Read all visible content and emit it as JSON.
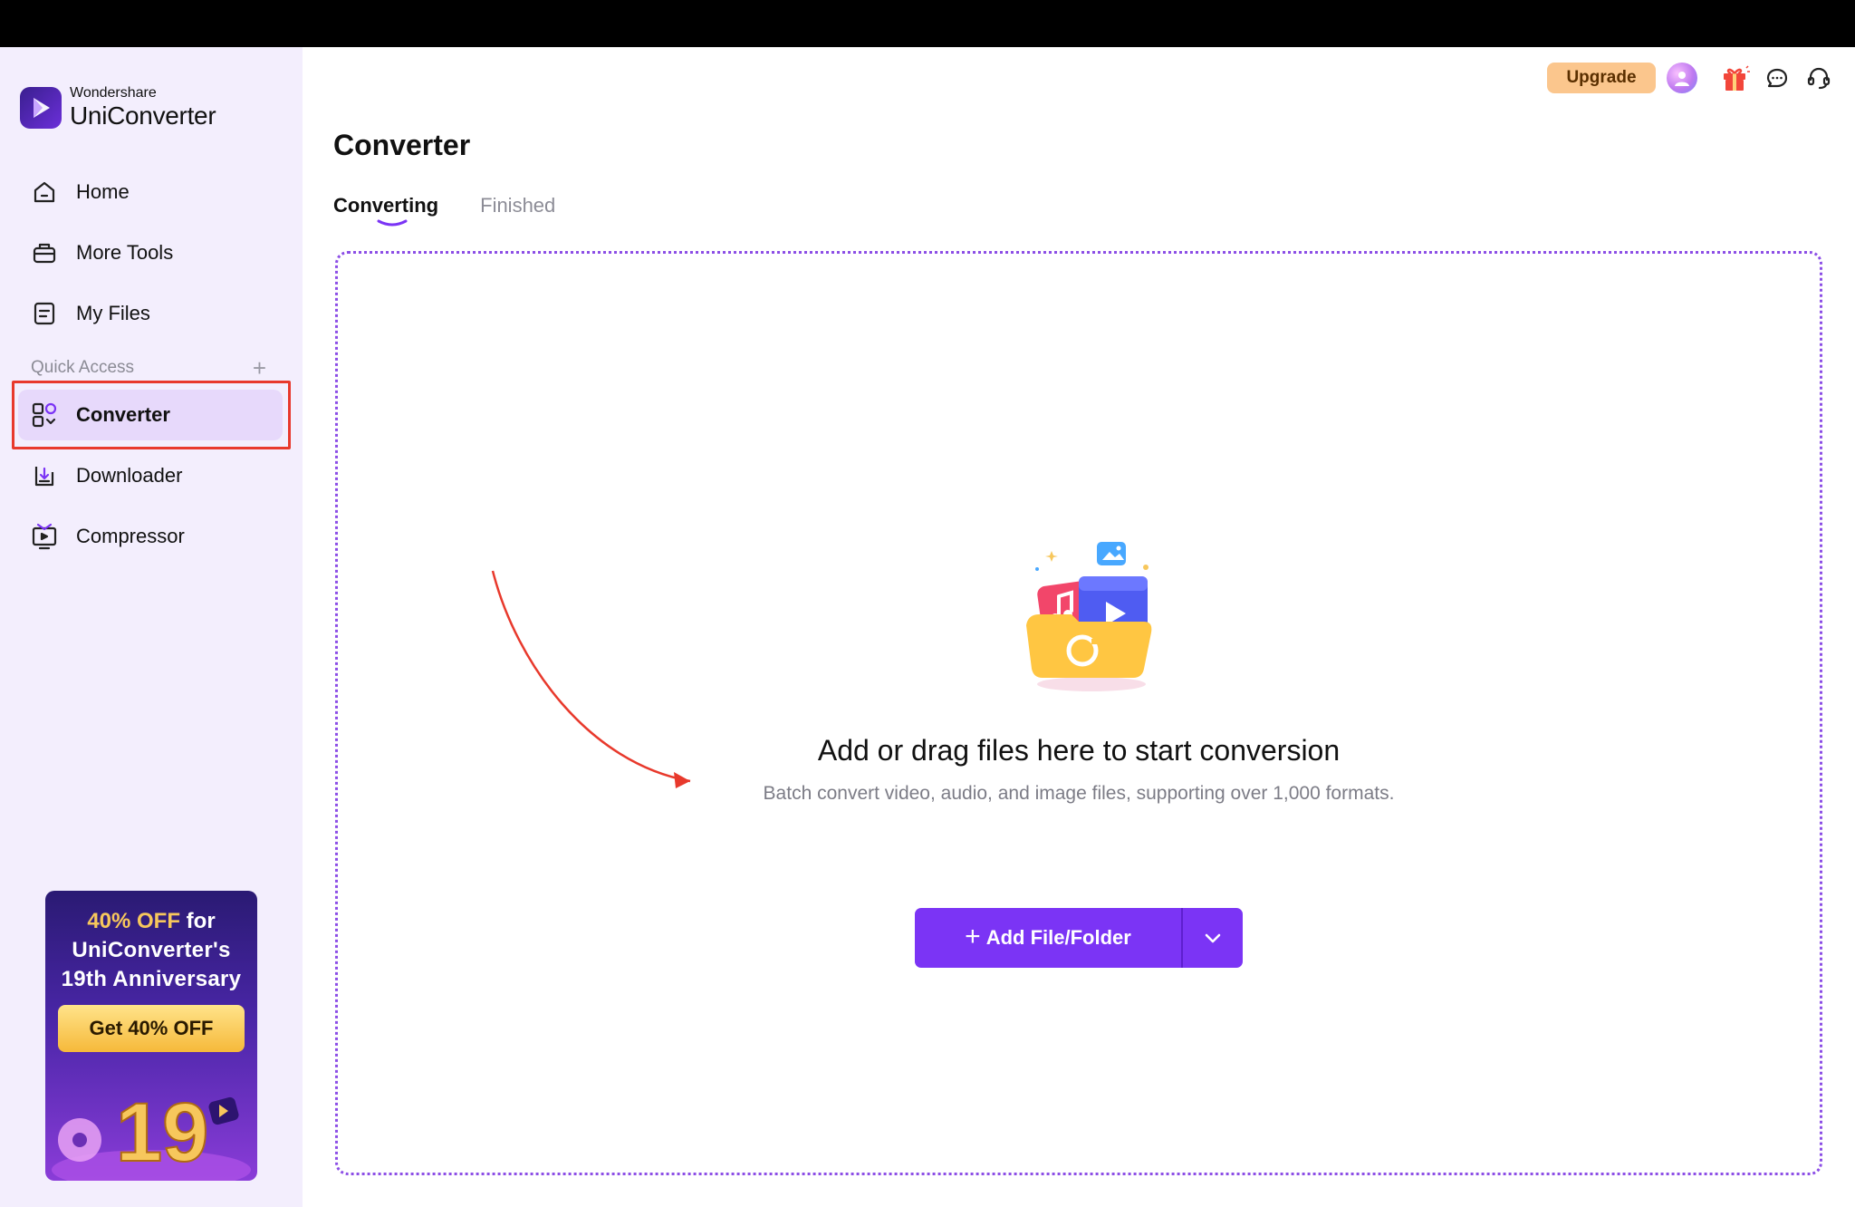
{
  "app": {
    "brand": "Wondershare",
    "product": "UniConverter"
  },
  "sidebar": {
    "items": [
      {
        "label": "Home",
        "icon": "home-icon"
      },
      {
        "label": "More Tools",
        "icon": "toolbox-icon"
      },
      {
        "label": "My Files",
        "icon": "files-icon"
      }
    ],
    "quick_access_label": "Quick Access",
    "quick_access_items": [
      {
        "label": "Converter",
        "icon": "converter-icon",
        "active": true
      },
      {
        "label": "Downloader",
        "icon": "downloader-icon"
      },
      {
        "label": "Compressor",
        "icon": "compressor-icon"
      }
    ]
  },
  "promo": {
    "highlight": "40% OFF",
    "line1_rest": " for",
    "line2": "UniConverter's",
    "line3": "19th Anniversary",
    "button": "Get 40% OFF"
  },
  "header": {
    "upgrade_label": "Upgrade"
  },
  "main": {
    "title": "Converter",
    "tabs": [
      {
        "label": "Converting",
        "active": true
      },
      {
        "label": "Finished",
        "active": false
      }
    ],
    "dropzone": {
      "title": "Add or drag files here to start conversion",
      "subtitle": "Batch convert video, audio, and image files, supporting over 1,000 formats.",
      "add_button": "Add File/Folder"
    }
  },
  "colors": {
    "accent": "#7b34f5",
    "sidebar_bg": "#f3eefd",
    "active_item_bg": "#e7d9fb",
    "upgrade_bg": "#fbc68d",
    "annotation_red": "#e8392c"
  }
}
